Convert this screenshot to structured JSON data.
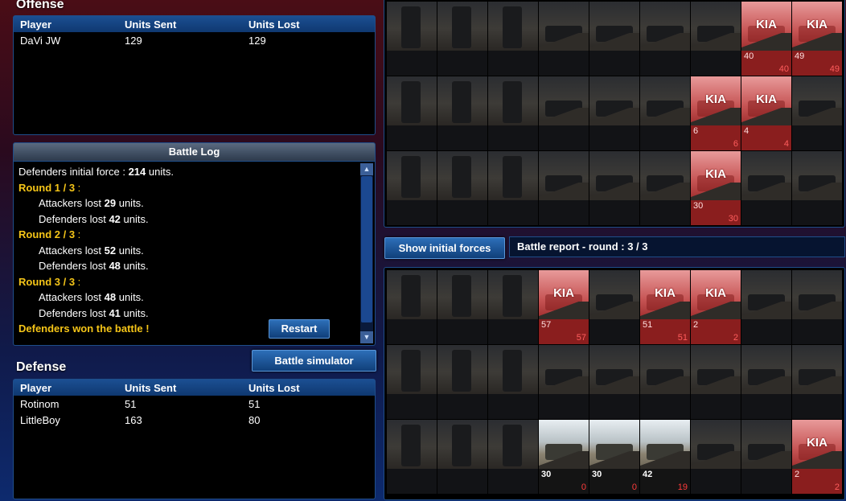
{
  "offense": {
    "title": "Offense",
    "headers": [
      "Player",
      "Units Sent",
      "Units Lost"
    ],
    "rows": [
      {
        "player": "DaVi JW",
        "sent": "129",
        "lost": "129"
      }
    ]
  },
  "battle_log": {
    "title": "Battle Log",
    "initial_prefix": "Defenders initial force : ",
    "initial_count": "214",
    "initial_suffix": " units.",
    "rounds": [
      {
        "label": "Round 1 / 3",
        "att_prefix": "Attackers lost ",
        "att": "29",
        "def_prefix": "Defenders lost ",
        "def": "42",
        "suffix": " units."
      },
      {
        "label": "Round 2 / 3",
        "att_prefix": "Attackers lost ",
        "att": "52",
        "def_prefix": "Defenders lost ",
        "def": "48",
        "suffix": " units."
      },
      {
        "label": "Round 3 / 3",
        "att_prefix": "Attackers lost ",
        "att": "48",
        "def_prefix": "Defenders lost ",
        "def": "41",
        "suffix": " units."
      }
    ],
    "round_colon": " :",
    "result": "Defenders won the battle !",
    "restart_label": "Restart"
  },
  "simulator_label": "Battle simulator",
  "defense": {
    "title": "Defense",
    "headers": [
      "Player",
      "Units Sent",
      "Units Lost"
    ],
    "rows": [
      {
        "player": "Rotinom",
        "sent": "51",
        "lost": "51"
      },
      {
        "player": "LittleBoy",
        "sent": "163",
        "lost": "80"
      }
    ]
  },
  "show_initial_label": "Show initial forces",
  "report_title": "Battle report - round : 3 / 3",
  "kia_label": "KIA",
  "offense_grid": [
    [
      {
        "s": "",
        "l": "",
        "kia": false
      },
      {
        "s": "",
        "l": "",
        "kia": false
      },
      {
        "s": "",
        "l": "",
        "kia": false
      },
      {
        "s": "",
        "l": "",
        "kia": false
      },
      {
        "s": "",
        "l": "",
        "kia": false
      },
      {
        "s": "",
        "l": "",
        "kia": false
      },
      {
        "s": "",
        "l": "",
        "kia": false
      },
      {
        "s": "40",
        "l": "40",
        "kia": true
      },
      {
        "s": "49",
        "l": "49",
        "kia": true
      }
    ],
    [
      {
        "s": "",
        "l": "",
        "kia": false
      },
      {
        "s": "",
        "l": "",
        "kia": false
      },
      {
        "s": "",
        "l": "",
        "kia": false
      },
      {
        "s": "",
        "l": "",
        "kia": false
      },
      {
        "s": "",
        "l": "",
        "kia": false
      },
      {
        "s": "",
        "l": "",
        "kia": false
      },
      {
        "s": "6",
        "l": "6",
        "kia": true
      },
      {
        "s": "4",
        "l": "4",
        "kia": true
      },
      {
        "s": "",
        "l": "",
        "kia": false
      }
    ],
    [
      {
        "s": "",
        "l": "",
        "kia": false
      },
      {
        "s": "",
        "l": "",
        "kia": false
      },
      {
        "s": "",
        "l": "",
        "kia": false
      },
      {
        "s": "",
        "l": "",
        "kia": false
      },
      {
        "s": "",
        "l": "",
        "kia": false
      },
      {
        "s": "",
        "l": "",
        "kia": false
      },
      {
        "s": "30",
        "l": "30",
        "kia": true
      },
      {
        "s": "",
        "l": "",
        "kia": false
      },
      {
        "s": "",
        "l": "",
        "kia": false
      }
    ]
  ],
  "defense_grid": [
    [
      {
        "s": "",
        "l": "",
        "kia": false
      },
      {
        "s": "",
        "l": "",
        "kia": false
      },
      {
        "s": "",
        "l": "",
        "kia": false
      },
      {
        "s": "57",
        "l": "57",
        "kia": true
      },
      {
        "s": "",
        "l": "",
        "kia": false
      },
      {
        "s": "51",
        "l": "51",
        "kia": true
      },
      {
        "s": "2",
        "l": "2",
        "kia": true
      },
      {
        "s": "",
        "l": "",
        "kia": false
      },
      {
        "s": "",
        "l": "",
        "kia": false
      }
    ],
    [
      {
        "s": "",
        "l": "",
        "kia": false
      },
      {
        "s": "",
        "l": "",
        "kia": false
      },
      {
        "s": "",
        "l": "",
        "kia": false
      },
      {
        "s": "",
        "l": "",
        "kia": false
      },
      {
        "s": "",
        "l": "",
        "kia": false
      },
      {
        "s": "",
        "l": "",
        "kia": false
      },
      {
        "s": "",
        "l": "",
        "kia": false
      },
      {
        "s": "",
        "l": "",
        "kia": false
      },
      {
        "s": "",
        "l": "",
        "kia": false
      }
    ],
    [
      {
        "s": "",
        "l": "",
        "kia": false
      },
      {
        "s": "",
        "l": "",
        "kia": false
      },
      {
        "s": "",
        "l": "",
        "kia": false
      },
      {
        "s": "30",
        "l": "0",
        "kia": false,
        "lit": true
      },
      {
        "s": "30",
        "l": "0",
        "kia": false,
        "lit": true
      },
      {
        "s": "42",
        "l": "19",
        "kia": false,
        "lit": true
      },
      {
        "s": "",
        "l": "",
        "kia": false
      },
      {
        "s": "",
        "l": "",
        "kia": false
      },
      {
        "s": "2",
        "l": "2",
        "kia": true
      }
    ]
  ]
}
